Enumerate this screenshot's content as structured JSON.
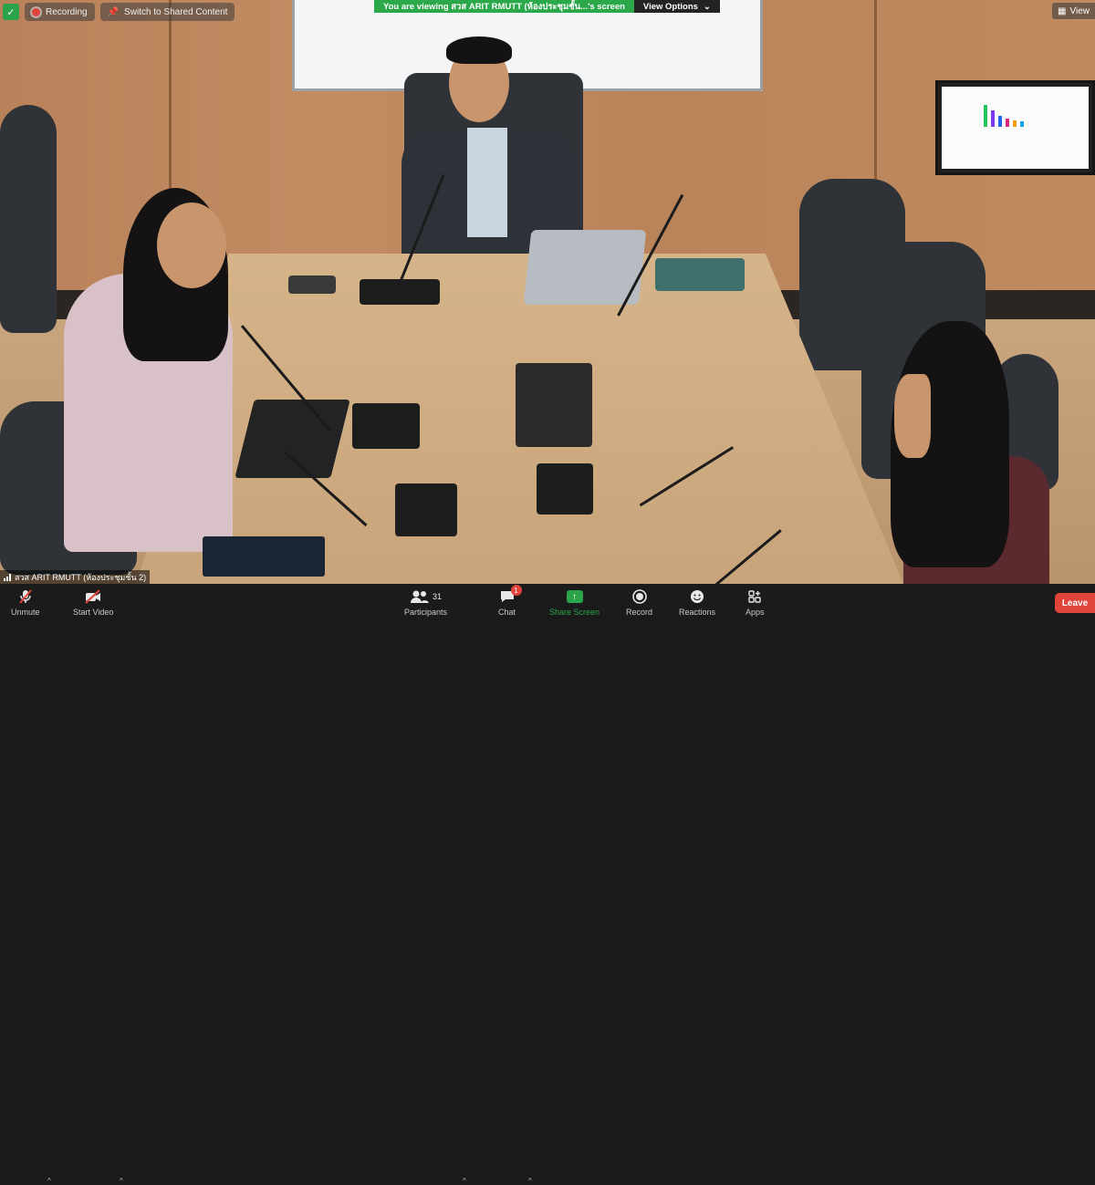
{
  "window": {
    "recording_label": "Recording",
    "switch_label": "Switch to Shared Content",
    "view_label": "View",
    "share_banner": "You are viewing สวส ARIT RMUTT (ห้องประชุมชั้น...'s screen",
    "view_options_label": "View Options",
    "participant_name": "สวส ARIT RMUTT (ห้องประชุมชั้น 2)"
  },
  "toolbar": {
    "unmute": "Unmute",
    "start_video": "Start Video",
    "participants": "Participants",
    "participant_count": "31",
    "chat": "Chat",
    "chat_badge": "1",
    "share_screen": "Share Screen",
    "record": "Record",
    "reactions": "Reactions",
    "apps": "Apps",
    "leave": "Leave"
  },
  "colors": {
    "share_green": "#2aa34a",
    "leave_red": "#e0443b",
    "toolbar_bg": "#1b1b1b"
  },
  "icons": {
    "security": "shield-icon",
    "recording": "record-dot-icon",
    "switch": "pin-icon",
    "unmute": "mic-muted-icon",
    "start_video": "camera-off-icon",
    "participants": "people-icon",
    "chat": "chat-bubble-icon",
    "share_screen": "share-arrow-icon",
    "record": "record-icon",
    "reactions": "smiley-icon",
    "apps": "apps-icon"
  }
}
